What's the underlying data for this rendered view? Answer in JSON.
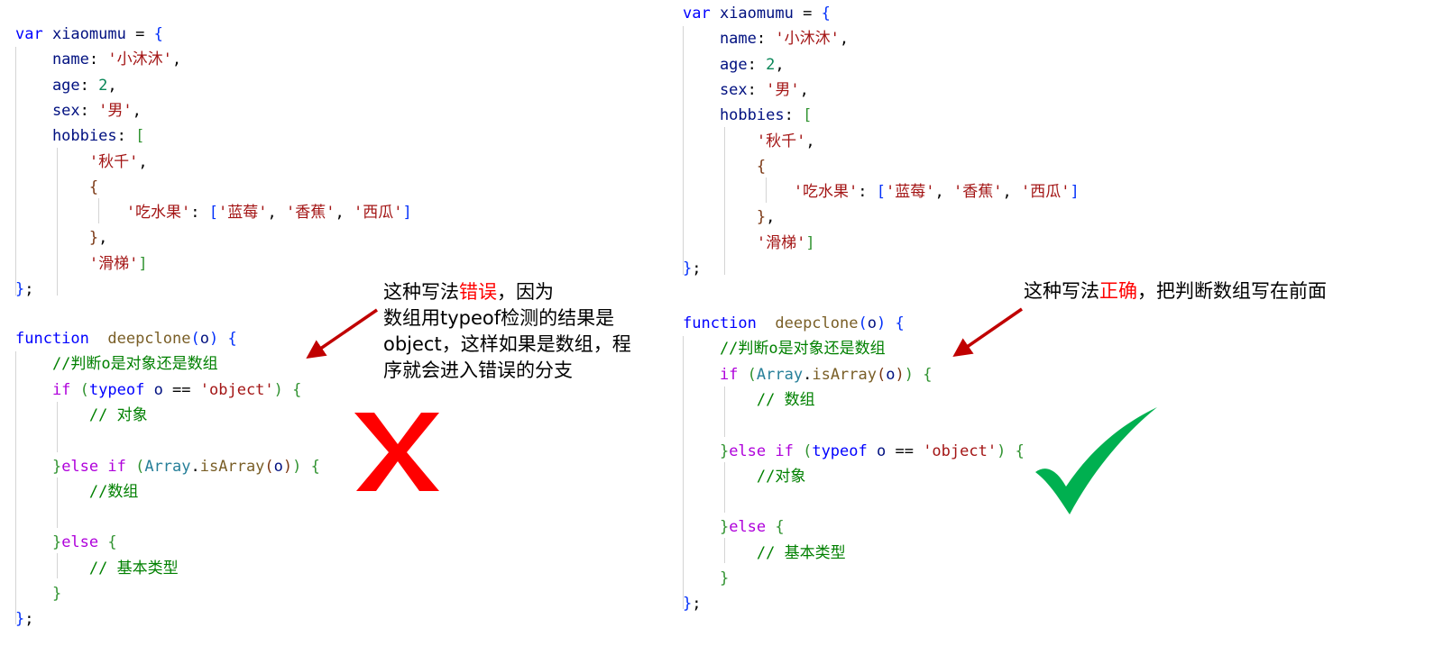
{
  "left": {
    "object_block": {
      "lines": [
        [
          {
            "t": "var",
            "c": "kw-blue"
          },
          {
            "t": " xiaomumu ",
            "c": "ident"
          },
          {
            "t": "= ",
            "c": "plain"
          },
          {
            "t": "{",
            "c": "b1"
          }
        ],
        [
          {
            "t": "    name",
            "c": "ident"
          },
          {
            "t": ": ",
            "c": "plain"
          },
          {
            "t": "'小沐沐'",
            "c": "str"
          },
          {
            "t": ",",
            "c": "plain"
          }
        ],
        [
          {
            "t": "    age",
            "c": "ident"
          },
          {
            "t": ": ",
            "c": "plain"
          },
          {
            "t": "2",
            "c": "num"
          },
          {
            "t": ",",
            "c": "plain"
          }
        ],
        [
          {
            "t": "    sex",
            "c": "ident"
          },
          {
            "t": ": ",
            "c": "plain"
          },
          {
            "t": "'男'",
            "c": "str"
          },
          {
            "t": ",",
            "c": "plain"
          }
        ],
        [
          {
            "t": "    hobbies",
            "c": "ident"
          },
          {
            "t": ": ",
            "c": "plain"
          },
          {
            "t": "[",
            "c": "b2"
          }
        ],
        [
          {
            "t": "        '秋千'",
            "c": "str"
          },
          {
            "t": ",",
            "c": "plain"
          }
        ],
        [
          {
            "t": "        {",
            "c": "b3"
          }
        ],
        [
          {
            "t": "            '吃水果'",
            "c": "str"
          },
          {
            "t": ": ",
            "c": "plain"
          },
          {
            "t": "[",
            "c": "b1"
          },
          {
            "t": "'蓝莓'",
            "c": "str"
          },
          {
            "t": ", ",
            "c": "plain"
          },
          {
            "t": "'香蕉'",
            "c": "str"
          },
          {
            "t": ", ",
            "c": "plain"
          },
          {
            "t": "'西瓜'",
            "c": "str"
          },
          {
            "t": "]",
            "c": "b1"
          }
        ],
        [
          {
            "t": "        }",
            "c": "b3"
          },
          {
            "t": ",",
            "c": "plain"
          }
        ],
        [
          {
            "t": "        '滑梯'",
            "c": "str"
          },
          {
            "t": "]",
            "c": "b2"
          }
        ],
        [
          {
            "t": "}",
            "c": "b1"
          },
          {
            "t": ";",
            "c": "plain"
          }
        ]
      ]
    },
    "function_block": {
      "lines": [
        [
          {
            "t": "function",
            "c": "kw-blue"
          },
          {
            "t": "  deepclone",
            "c": "fn"
          },
          {
            "t": "(",
            "c": "b1"
          },
          {
            "t": "o",
            "c": "ident"
          },
          {
            "t": ")",
            "c": "b1"
          },
          {
            "t": " {",
            "c": "b1"
          }
        ],
        [
          {
            "t": "    //判断o是对象还是数组",
            "c": "cmt"
          }
        ],
        [
          {
            "t": "    if",
            "c": "kw-purple"
          },
          {
            "t": " (",
            "c": "b2"
          },
          {
            "t": "typeof",
            "c": "kw-blue"
          },
          {
            "t": " o ",
            "c": "ident"
          },
          {
            "t": "== ",
            "c": "plain"
          },
          {
            "t": "'object'",
            "c": "str"
          },
          {
            "t": ")",
            "c": "b2"
          },
          {
            "t": " {",
            "c": "b2"
          }
        ],
        [
          {
            "t": "        // 对象",
            "c": "cmt"
          }
        ],
        [],
        [
          {
            "t": "    }",
            "c": "b2"
          },
          {
            "t": "else if",
            "c": "kw-purple"
          },
          {
            "t": " (",
            "c": "b2"
          },
          {
            "t": "Array",
            "c": "ty"
          },
          {
            "t": ".",
            "c": "plain"
          },
          {
            "t": "isArray",
            "c": "fn"
          },
          {
            "t": "(",
            "c": "b3"
          },
          {
            "t": "o",
            "c": "ident"
          },
          {
            "t": ")",
            "c": "b3"
          },
          {
            "t": ")",
            "c": "b2"
          },
          {
            "t": " {",
            "c": "b2"
          }
        ],
        [
          {
            "t": "        //数组",
            "c": "cmt"
          }
        ],
        [],
        [
          {
            "t": "    }",
            "c": "b2"
          },
          {
            "t": "else",
            "c": "kw-purple"
          },
          {
            "t": " {",
            "c": "b2"
          }
        ],
        [
          {
            "t": "        // 基本类型",
            "c": "cmt"
          }
        ],
        [
          {
            "t": "    }",
            "c": "b2"
          }
        ],
        [
          {
            "t": "}",
            "c": "b1"
          },
          {
            "t": ";",
            "c": "plain"
          }
        ]
      ]
    },
    "annotation": {
      "lines": [
        [
          {
            "t": "这种写法"
          },
          {
            "t": "错误",
            "hl": true
          },
          {
            "t": "，因为"
          }
        ],
        [
          {
            "t": "数组用typeof检测的结果是"
          }
        ],
        [
          {
            "t": "object，这样如果是数组，程"
          }
        ],
        [
          {
            "t": "序就会进入错误的分支"
          }
        ]
      ]
    },
    "verdict": "wrong",
    "verdict_color": "#ff0000"
  },
  "right": {
    "object_block": {
      "lines": [
        [
          {
            "t": "var",
            "c": "kw-blue"
          },
          {
            "t": " xiaomumu ",
            "c": "ident"
          },
          {
            "t": "= ",
            "c": "plain"
          },
          {
            "t": "{",
            "c": "b1"
          }
        ],
        [
          {
            "t": "    name",
            "c": "ident"
          },
          {
            "t": ": ",
            "c": "plain"
          },
          {
            "t": "'小沐沐'",
            "c": "str"
          },
          {
            "t": ",",
            "c": "plain"
          }
        ],
        [
          {
            "t": "    age",
            "c": "ident"
          },
          {
            "t": ": ",
            "c": "plain"
          },
          {
            "t": "2",
            "c": "num"
          },
          {
            "t": ",",
            "c": "plain"
          }
        ],
        [
          {
            "t": "    sex",
            "c": "ident"
          },
          {
            "t": ": ",
            "c": "plain"
          },
          {
            "t": "'男'",
            "c": "str"
          },
          {
            "t": ",",
            "c": "plain"
          }
        ],
        [
          {
            "t": "    hobbies",
            "c": "ident"
          },
          {
            "t": ": ",
            "c": "plain"
          },
          {
            "t": "[",
            "c": "b2"
          }
        ],
        [
          {
            "t": "        '秋千'",
            "c": "str"
          },
          {
            "t": ",",
            "c": "plain"
          }
        ],
        [
          {
            "t": "        {",
            "c": "b3"
          }
        ],
        [
          {
            "t": "            '吃水果'",
            "c": "str"
          },
          {
            "t": ": ",
            "c": "plain"
          },
          {
            "t": "[",
            "c": "b1"
          },
          {
            "t": "'蓝莓'",
            "c": "str"
          },
          {
            "t": ", ",
            "c": "plain"
          },
          {
            "t": "'香蕉'",
            "c": "str"
          },
          {
            "t": ", ",
            "c": "plain"
          },
          {
            "t": "'西瓜'",
            "c": "str"
          },
          {
            "t": "]",
            "c": "b1"
          }
        ],
        [
          {
            "t": "        }",
            "c": "b3"
          },
          {
            "t": ",",
            "c": "plain"
          }
        ],
        [
          {
            "t": "        '滑梯'",
            "c": "str"
          },
          {
            "t": "]",
            "c": "b2"
          }
        ],
        [
          {
            "t": "}",
            "c": "b1"
          },
          {
            "t": ";",
            "c": "plain"
          }
        ]
      ]
    },
    "function_block": {
      "lines": [
        [
          {
            "t": "function",
            "c": "kw-blue"
          },
          {
            "t": "  deepclone",
            "c": "fn"
          },
          {
            "t": "(",
            "c": "b1"
          },
          {
            "t": "o",
            "c": "ident"
          },
          {
            "t": ")",
            "c": "b1"
          },
          {
            "t": " {",
            "c": "b1"
          }
        ],
        [
          {
            "t": "    //判断o是对象还是数组",
            "c": "cmt"
          }
        ],
        [
          {
            "t": "    if",
            "c": "kw-purple"
          },
          {
            "t": " (",
            "c": "b2"
          },
          {
            "t": "Array",
            "c": "ty"
          },
          {
            "t": ".",
            "c": "plain"
          },
          {
            "t": "isArray",
            "c": "fn"
          },
          {
            "t": "(",
            "c": "b3"
          },
          {
            "t": "o",
            "c": "ident"
          },
          {
            "t": ")",
            "c": "b3"
          },
          {
            "t": ")",
            "c": "b2"
          },
          {
            "t": " {",
            "c": "b2"
          }
        ],
        [
          {
            "t": "        // 数组",
            "c": "cmt"
          }
        ],
        [],
        [
          {
            "t": "    }",
            "c": "b2"
          },
          {
            "t": "else if",
            "c": "kw-purple"
          },
          {
            "t": " (",
            "c": "b2"
          },
          {
            "t": "typeof",
            "c": "kw-blue"
          },
          {
            "t": " o ",
            "c": "ident"
          },
          {
            "t": "== ",
            "c": "plain"
          },
          {
            "t": "'object'",
            "c": "str"
          },
          {
            "t": ")",
            "c": "b2"
          },
          {
            "t": " {",
            "c": "b2"
          }
        ],
        [
          {
            "t": "        //对象",
            "c": "cmt"
          }
        ],
        [],
        [
          {
            "t": "    }",
            "c": "b2"
          },
          {
            "t": "else",
            "c": "kw-purple"
          },
          {
            "t": " {",
            "c": "b2"
          }
        ],
        [
          {
            "t": "        // 基本类型",
            "c": "cmt"
          }
        ],
        [
          {
            "t": "    }",
            "c": "b2"
          }
        ],
        [
          {
            "t": "}",
            "c": "b1"
          },
          {
            "t": ";",
            "c": "plain"
          }
        ]
      ]
    },
    "annotation": {
      "lines": [
        [
          {
            "t": "这种写法"
          },
          {
            "t": "正确",
            "hl": true
          },
          {
            "t": "，把判断数组写在前面"
          }
        ]
      ]
    },
    "verdict": "correct",
    "verdict_color": "#00b050"
  },
  "colors": {
    "arrow": "#c00000",
    "highlight_text": "#ff0000"
  }
}
